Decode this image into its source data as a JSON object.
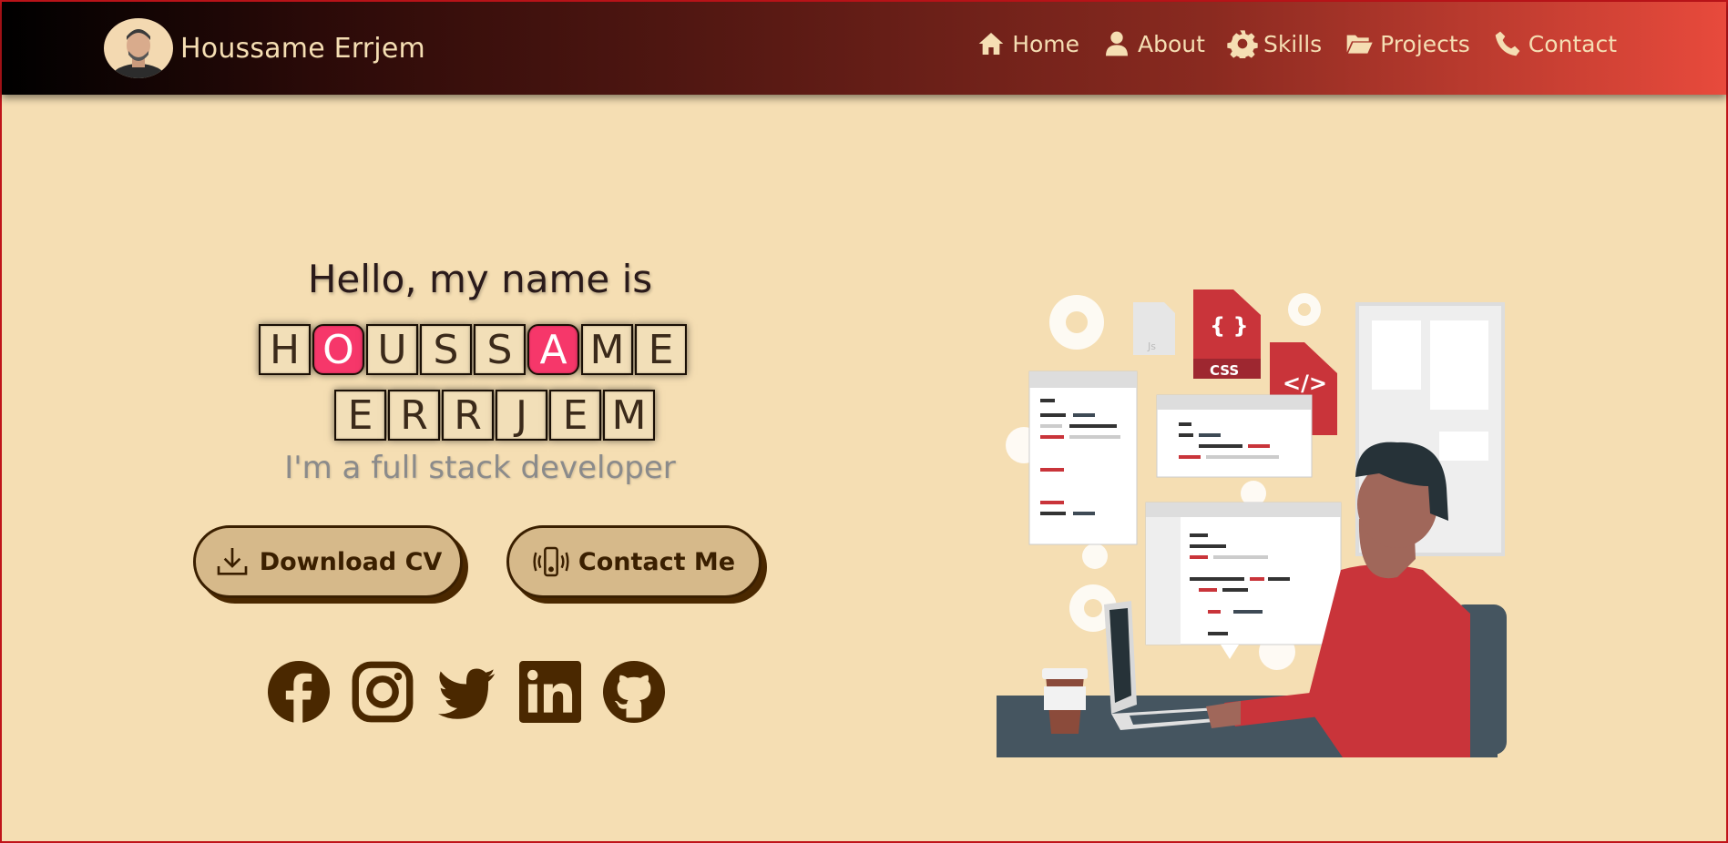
{
  "brand": {
    "name": "Houssame Errjem"
  },
  "nav": {
    "items": [
      {
        "label": "Home",
        "icon": "home-icon"
      },
      {
        "label": "About",
        "icon": "user-icon"
      },
      {
        "label": "Skills",
        "icon": "gear-icon"
      },
      {
        "label": "Projects",
        "icon": "folder-icon"
      },
      {
        "label": "Contact",
        "icon": "phone-icon"
      }
    ]
  },
  "hero": {
    "greeting": "Hello, my name is",
    "first_name_letters": [
      "H",
      "O",
      "U",
      "S",
      "S",
      "A",
      "M",
      "E"
    ],
    "last_name_letters": [
      "E",
      "R",
      "R",
      "J",
      "E",
      "M"
    ],
    "tagline": "I'm a full stack developer",
    "download_label": "Download CV",
    "contact_label": "Contact Me"
  },
  "socials": [
    "facebook-icon",
    "instagram-icon",
    "twitter-icon",
    "linkedin-icon",
    "github-icon"
  ],
  "illustration": {
    "css_label": "CSS",
    "html_label": "</>",
    "js_label": "Js"
  },
  "colors": {
    "accent": "#f6376a",
    "brown": "#3a1f00",
    "background": "#f5deb3"
  }
}
